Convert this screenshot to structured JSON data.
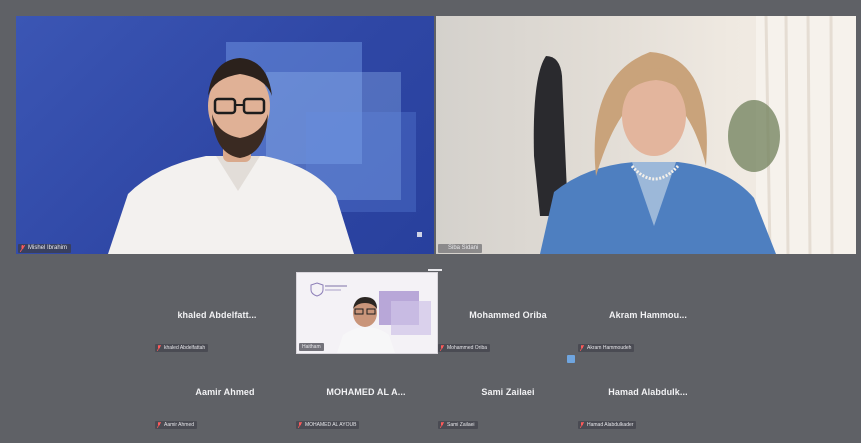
{
  "speakers": [
    {
      "id": "left",
      "name_tag": "Mishel Ibrahim"
    },
    {
      "id": "right",
      "name_tag": "Siba Sidani"
    }
  ],
  "video_participant": {
    "name_tag": "Haitham"
  },
  "participants_row1": [
    {
      "name": "khaled  Abdelfatt...",
      "tag": "khaled Abdelfattah"
    },
    {
      "name": "Mohammed Oriba",
      "tag": "Mohammed Oriba"
    },
    {
      "name": "Akram  Hammou...",
      "tag": "Akram Hammoudeh"
    }
  ],
  "participants_row2": [
    {
      "name": "Aamir Ahmed",
      "tag": "Aamir Ahmed"
    },
    {
      "name": "MOHAMED AL A...",
      "tag": "MOHAMED AL AYOUB"
    },
    {
      "name": "Sami Zailaei",
      "tag": "Sami Zailaei"
    },
    {
      "name": "Hamad  Alabdulk...",
      "tag": "Hamad Alabdulkader"
    }
  ],
  "colors": {
    "background": "#5f6166",
    "left_tile": "#2f47a5",
    "name_text": "#f2f2f4",
    "notify": "#6fa5df"
  },
  "icons": [
    "mic-muted-icon",
    "shield-icon",
    "notification-square-icon"
  ]
}
